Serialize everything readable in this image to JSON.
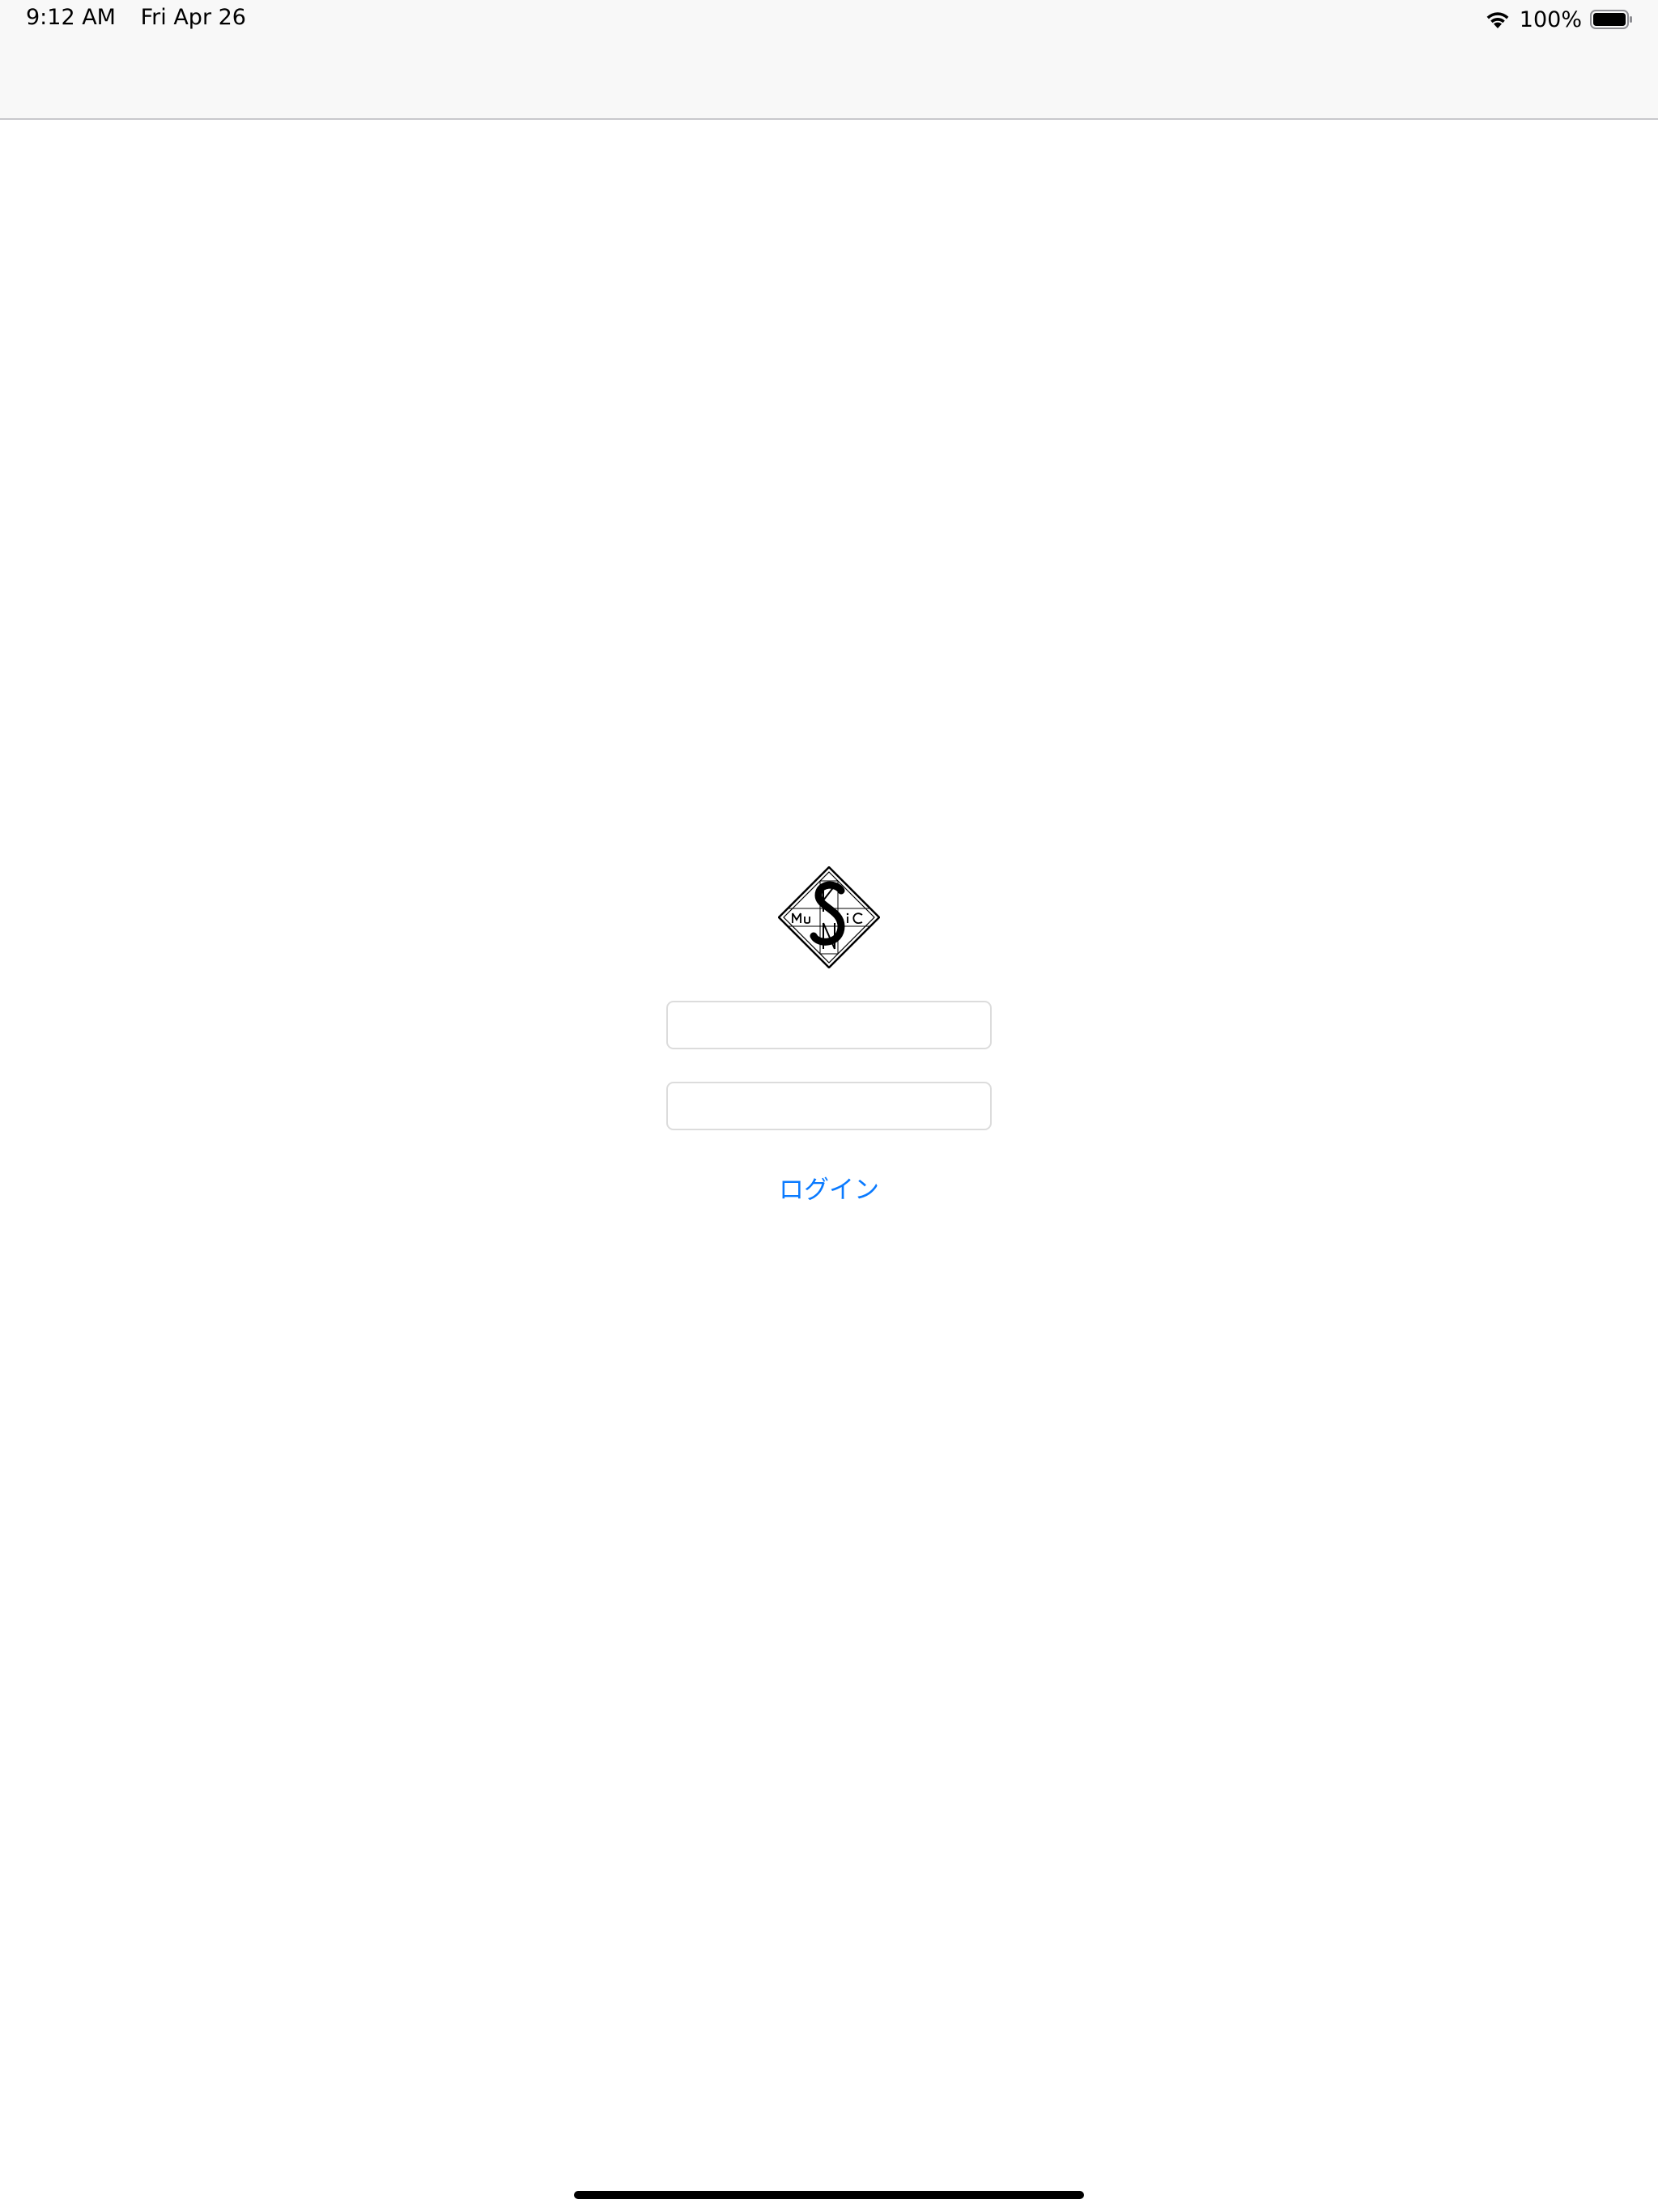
{
  "status_bar": {
    "time": "9:12 AM",
    "date": "Fri Apr 26",
    "battery_percent": "100%",
    "battery_level": 1.0,
    "icons": [
      "wifi-icon",
      "battery-icon"
    ]
  },
  "login": {
    "username_placeholder": "",
    "password_placeholder": "",
    "login_button_label": "ログイン"
  },
  "colors": {
    "accent": "#0a7aff",
    "bar_background": "#f8f8f8",
    "field_border": "#dcdcdc"
  }
}
